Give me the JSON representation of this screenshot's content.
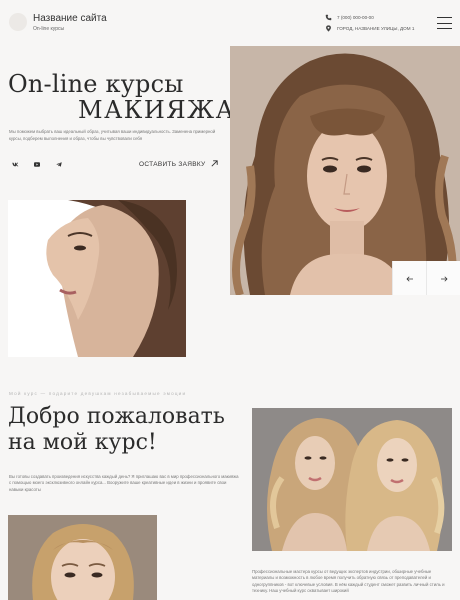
{
  "header": {
    "site_title": "Название сайта",
    "site_subtitle": "On-line курсы",
    "phone": "7 (000) 000-00-00",
    "address": "ГОРОД, НАЗВАНИЕ УЛИЦЫ, ДОМ 1",
    "icons": {
      "phone": "phone-icon",
      "location": "location-pin-icon",
      "menu": "hamburger-menu-icon"
    }
  },
  "hero": {
    "title_line1": "On-line курсы",
    "title_line2": "МАКИЯЖА",
    "description": "Мы поможем выбрать ваш идеальный образ, учитывая ваши индивидуальность. Заменена примерной курсы, подберем выполнения и образ, чтобы вы чувствовали себя",
    "socials": [
      "vk-icon",
      "youtube-icon",
      "telegram-icon"
    ],
    "cta_label": "ОСТАВИТЬ ЗАЯВКУ"
  },
  "slider": {
    "prev_icon": "arrow-left-icon",
    "next_icon": "arrow-right-icon"
  },
  "about": {
    "eyebrow": "Мой курс — подарите девушкам незабываемые эмоции",
    "title": "Добро пожаловать на мой курс!",
    "description": "Вы готовы создавать произведения искусства каждый день? Я приглашаю вас в мир профессионального макияжа с помощью моего эксклюзивного онлайн курса... Вооружите ваше креативные идеи в жизни и проявите свои навыки красоты",
    "side_text": "Профессиональные мастера курсы от ведущих экспертов индустрии, обширные учебные материалы и возможность в любое время получить обратную связь от преподавателей и одногруппников - вот ключевые условия. В нём каждый студент сможет развить личный стиль и технику. Наш учебный курс охватывает широкий"
  },
  "colors": {
    "background": "#f7f6f5",
    "text": "#2b2b2b",
    "muted": "#777777"
  }
}
